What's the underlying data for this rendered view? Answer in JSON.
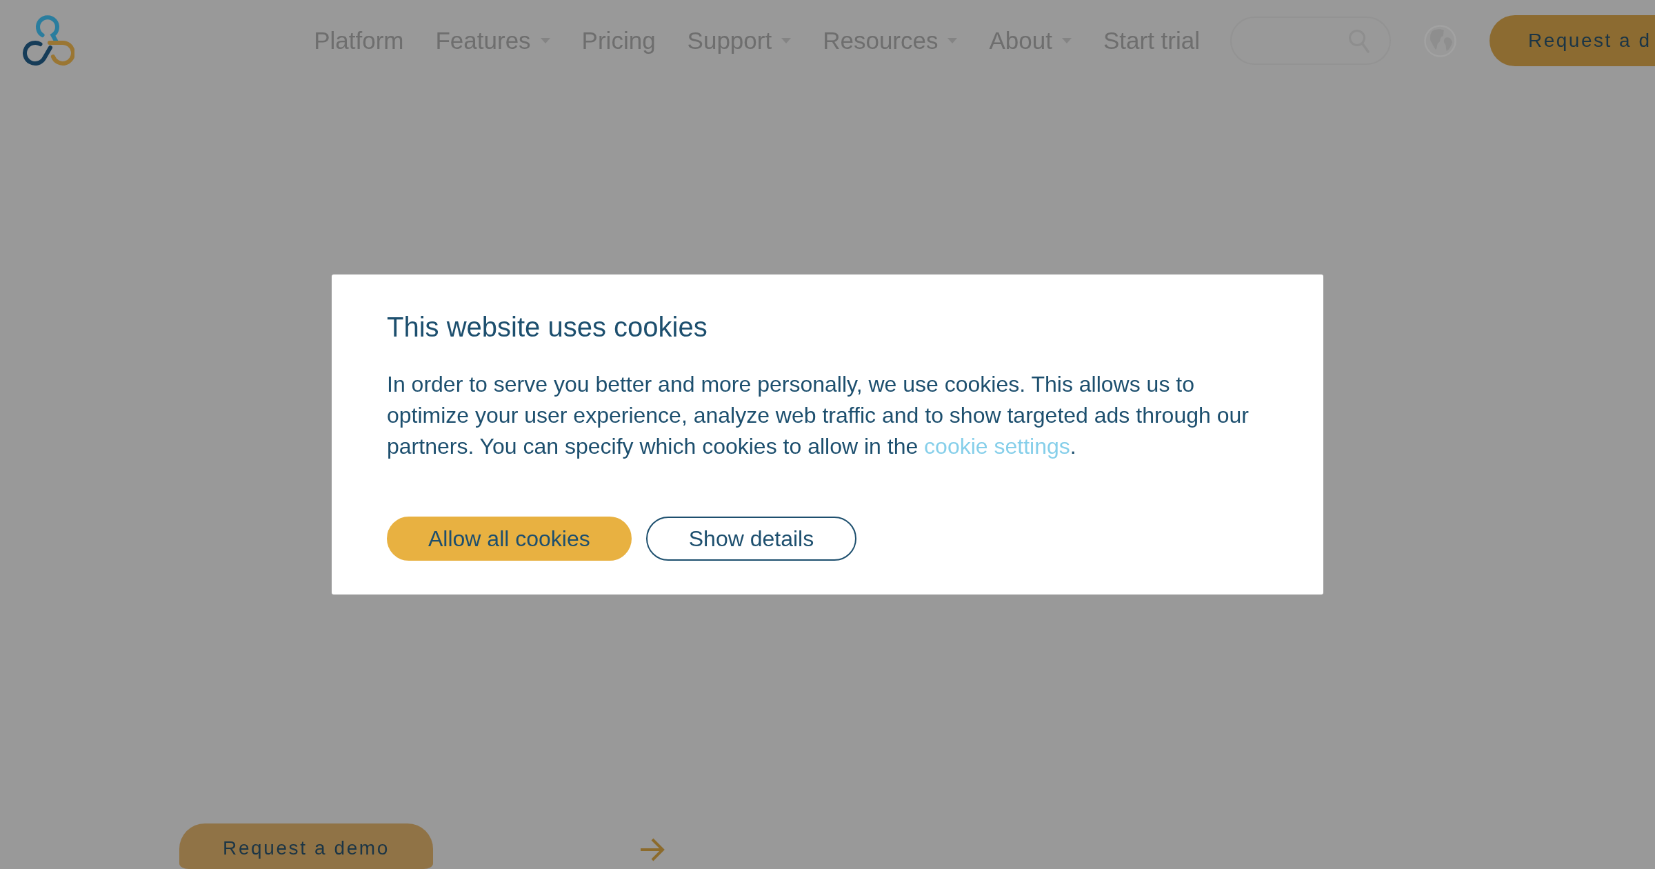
{
  "header": {
    "nav": [
      {
        "label": "Platform",
        "dropdown": false
      },
      {
        "label": "Features",
        "dropdown": true
      },
      {
        "label": "Pricing",
        "dropdown": false
      },
      {
        "label": "Support",
        "dropdown": true
      },
      {
        "label": "Resources",
        "dropdown": true
      },
      {
        "label": "About",
        "dropdown": true
      },
      {
        "label": "Start trial",
        "dropdown": false
      }
    ],
    "cta_button": "Request a d"
  },
  "cookie_dialog": {
    "title": "This website uses cookies",
    "message": {
      "text": "In order to serve you better and more personally, we use cookies. This allows us to optimize your user experience, analyze web traffic and to show targeted ads through our partners. You can specify which cookies to allow in the ",
      "link": "cookie settings",
      "after": "."
    },
    "buttons": [
      {
        "label": "Allow all cookies",
        "kind": "primary"
      },
      {
        "label": "Show details",
        "kind": "outline"
      }
    ]
  },
  "hero": {
    "cta_button": "Request a demo"
  }
}
